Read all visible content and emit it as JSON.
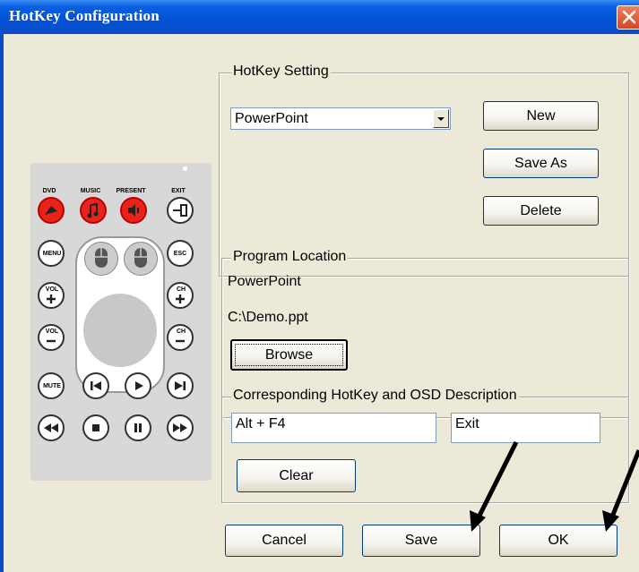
{
  "window": {
    "title": "HotKey Configuration",
    "close_icon": "close-icon"
  },
  "hotkey_setting": {
    "legend": "HotKey Setting",
    "selected_program": "PowerPoint",
    "new_label": "New",
    "save_as_label": "Save As",
    "delete_label": "Delete"
  },
  "program_location": {
    "legend": "Program Location",
    "name": "PowerPoint",
    "path": "C:\\Demo.ppt",
    "browse_label": "Browse"
  },
  "corresponding": {
    "legend": "Corresponding HotKey and OSD Description",
    "hotkey_value": "Alt + F4",
    "osd_value": "Exit",
    "clear_label": "Clear"
  },
  "footer": {
    "cancel_label": "Cancel",
    "save_label": "Save",
    "ok_label": "OK"
  },
  "remote": {
    "labels": {
      "dvd": "DVD",
      "music": "MUSIC",
      "present": "PRESENT",
      "exit": "EXIT",
      "menu": "MENU",
      "esc": "ESC",
      "vol": "VOL",
      "ch": "CH",
      "mute": "MUTE"
    },
    "accent_color": "#e8231c"
  },
  "colors": {
    "titlebar": "#0450d6",
    "dialog_bg": "#ece9d8",
    "arrow": "#000000"
  }
}
